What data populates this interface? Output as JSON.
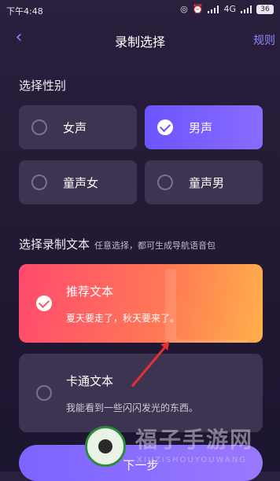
{
  "status": {
    "time": "下午4:48",
    "network": "4G",
    "battery": "36"
  },
  "nav": {
    "back_icon": "chevron-left-icon",
    "title": "录制选择",
    "rules": "规则"
  },
  "gender_section": {
    "title": "选择性别",
    "options": [
      {
        "label": "女声",
        "selected": false
      },
      {
        "label": "男声",
        "selected": true
      },
      {
        "label": "童声女",
        "selected": false
      },
      {
        "label": "童声男",
        "selected": false
      }
    ]
  },
  "text_section": {
    "title": "选择录制文本",
    "hint": "任意选择，都可生成导航语音包",
    "options": [
      {
        "title": "推荐文本",
        "sample": "夏天要走了，秋天要来了。",
        "selected": true
      },
      {
        "title": "卡通文本",
        "sample": "我能看到一些闪闪发光的东西。",
        "selected": false
      }
    ]
  },
  "next_button": {
    "label": "下一步"
  },
  "watermark": {
    "cn": "福子手游网",
    "en": "XIUZISHOUYOUWANG"
  },
  "colors": {
    "accent": "#7c64ff",
    "selected_gradient_start": "#ff4a6e",
    "selected_gradient_end": "#ffb04a",
    "card": "#3d3452"
  }
}
